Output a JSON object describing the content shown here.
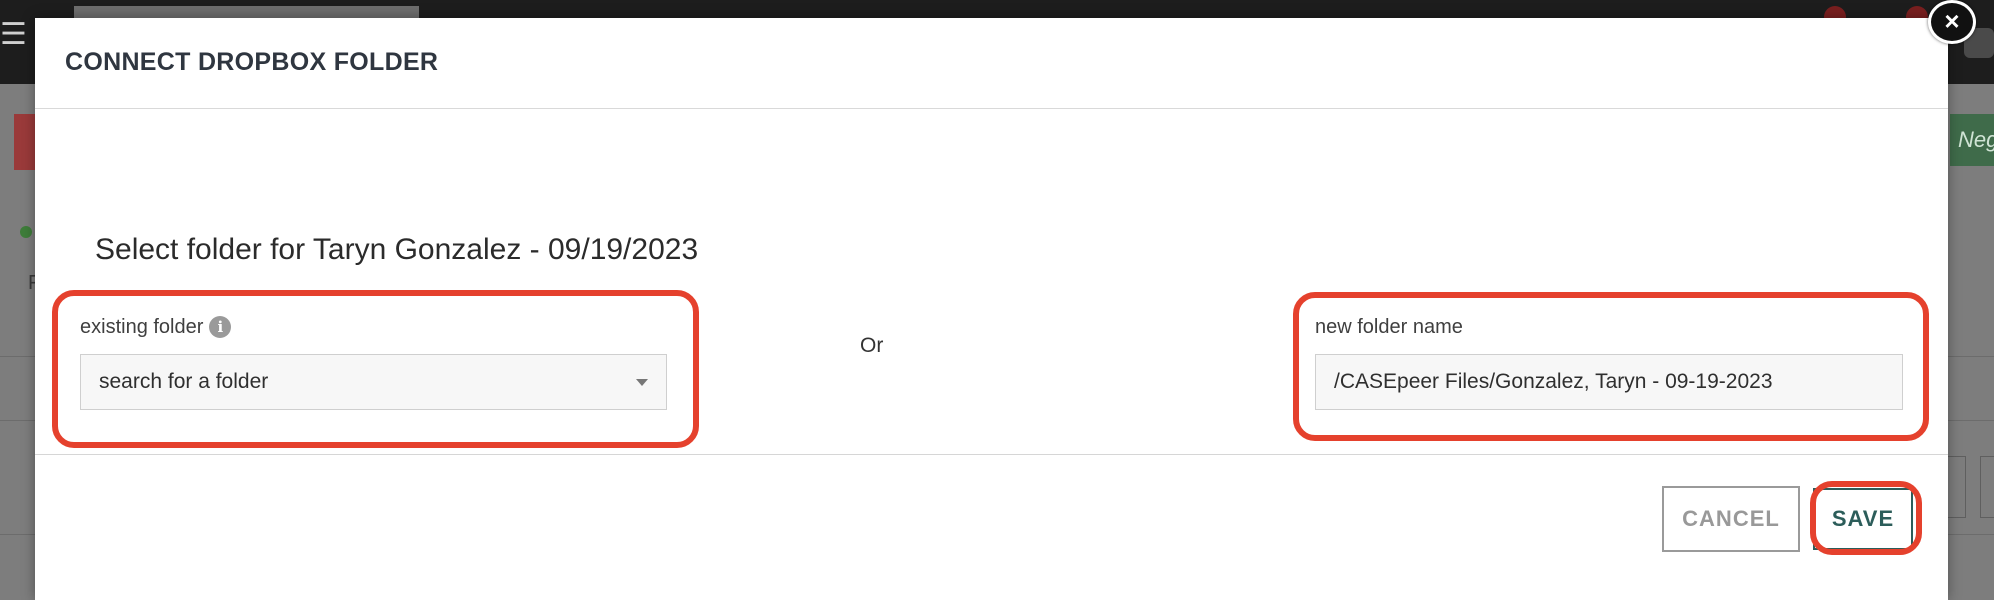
{
  "modal": {
    "title": "CONNECT DROPBOX FOLDER",
    "close_symbol": "×",
    "subtitle": "Select folder for Taryn Gonzalez - 09/19/2023",
    "existing_folder": {
      "label": "existing folder",
      "info_icon": "i",
      "placeholder": "search for a folder"
    },
    "or_label": "Or",
    "new_folder": {
      "label": "new folder name",
      "value": "/CASEpeer Files/Gonzalez, Taryn - 09-19-2023"
    },
    "buttons": {
      "cancel": "CANCEL",
      "save": "SAVE"
    }
  },
  "background": {
    "hamburger_symbol": "☰",
    "partial_button_text": "Neg",
    "partial_letter": "F"
  },
  "colors": {
    "highlight": "#e5412d",
    "save_accent": "#2c5d5a",
    "title_text": "#2f3640"
  }
}
